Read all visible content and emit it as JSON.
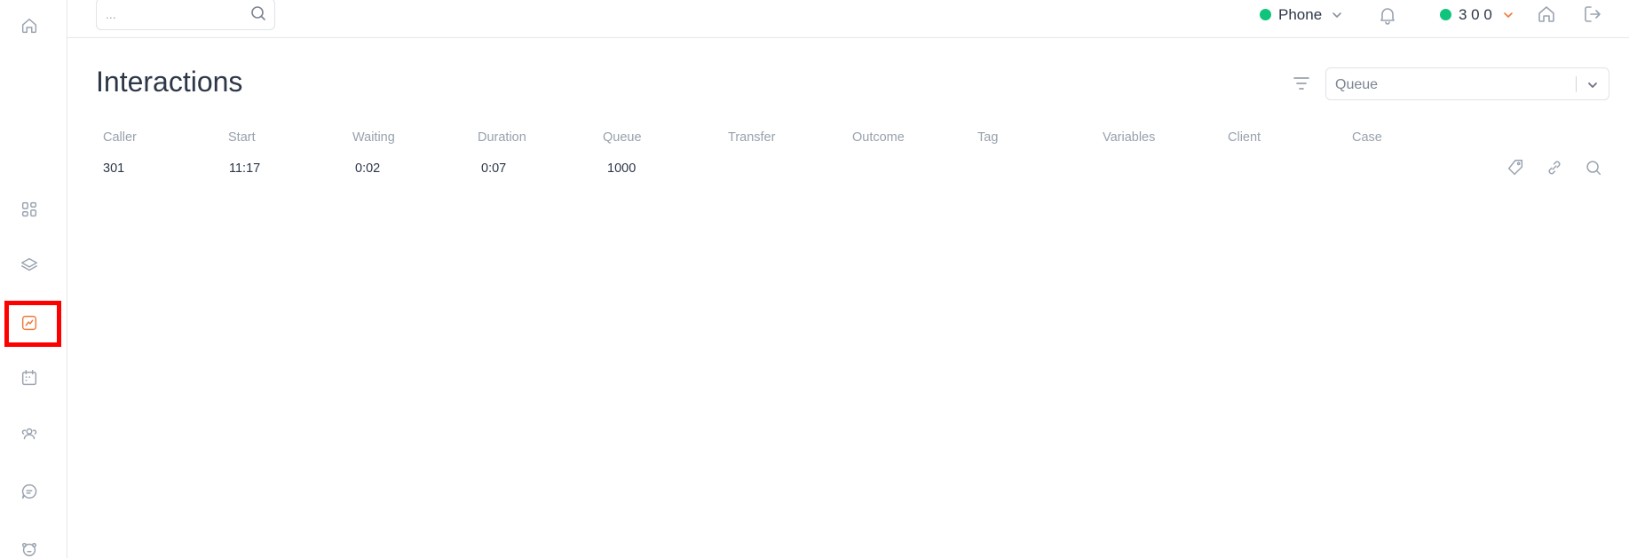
{
  "search": {
    "placeholder": "..."
  },
  "topbar": {
    "phone_label": "Phone",
    "phone_status_color": "#10c47b",
    "extension_label": "3 0 0",
    "extension_status_color": "#10c47b",
    "icons": [
      "bell-icon",
      "home-icon",
      "logout-icon"
    ]
  },
  "sidebar": {
    "items": [
      {
        "name": "home-icon",
        "active": false
      },
      {
        "name": "dashboard-grid-icon",
        "active": false
      },
      {
        "name": "layers-icon",
        "active": false
      },
      {
        "name": "chart-icon",
        "active": true
      },
      {
        "name": "calendar-icon",
        "active": false
      },
      {
        "name": "users-icon",
        "active": false
      },
      {
        "name": "chat-icon",
        "active": false
      },
      {
        "name": "bear-icon",
        "active": false
      }
    ],
    "accent_color": "#f07a3c",
    "highlight_color": "#ff0000"
  },
  "main": {
    "title": "Interactions",
    "queue_filter": {
      "label": "Queue"
    },
    "table": {
      "headers": [
        "Caller",
        "Start",
        "Waiting",
        "Duration",
        "Queue",
        "Transfer",
        "Outcome",
        "Tag",
        "Variables",
        "Client",
        "Case"
      ],
      "rows": [
        {
          "caller": "301",
          "start": "11:17",
          "waiting": "0:02",
          "duration": "0:07",
          "queue": "1000",
          "transfer": "",
          "outcome": "",
          "tag": "",
          "variables": "",
          "client": "",
          "case": ""
        }
      ],
      "row_actions": [
        "tag-icon",
        "link-icon",
        "search-icon"
      ]
    }
  }
}
